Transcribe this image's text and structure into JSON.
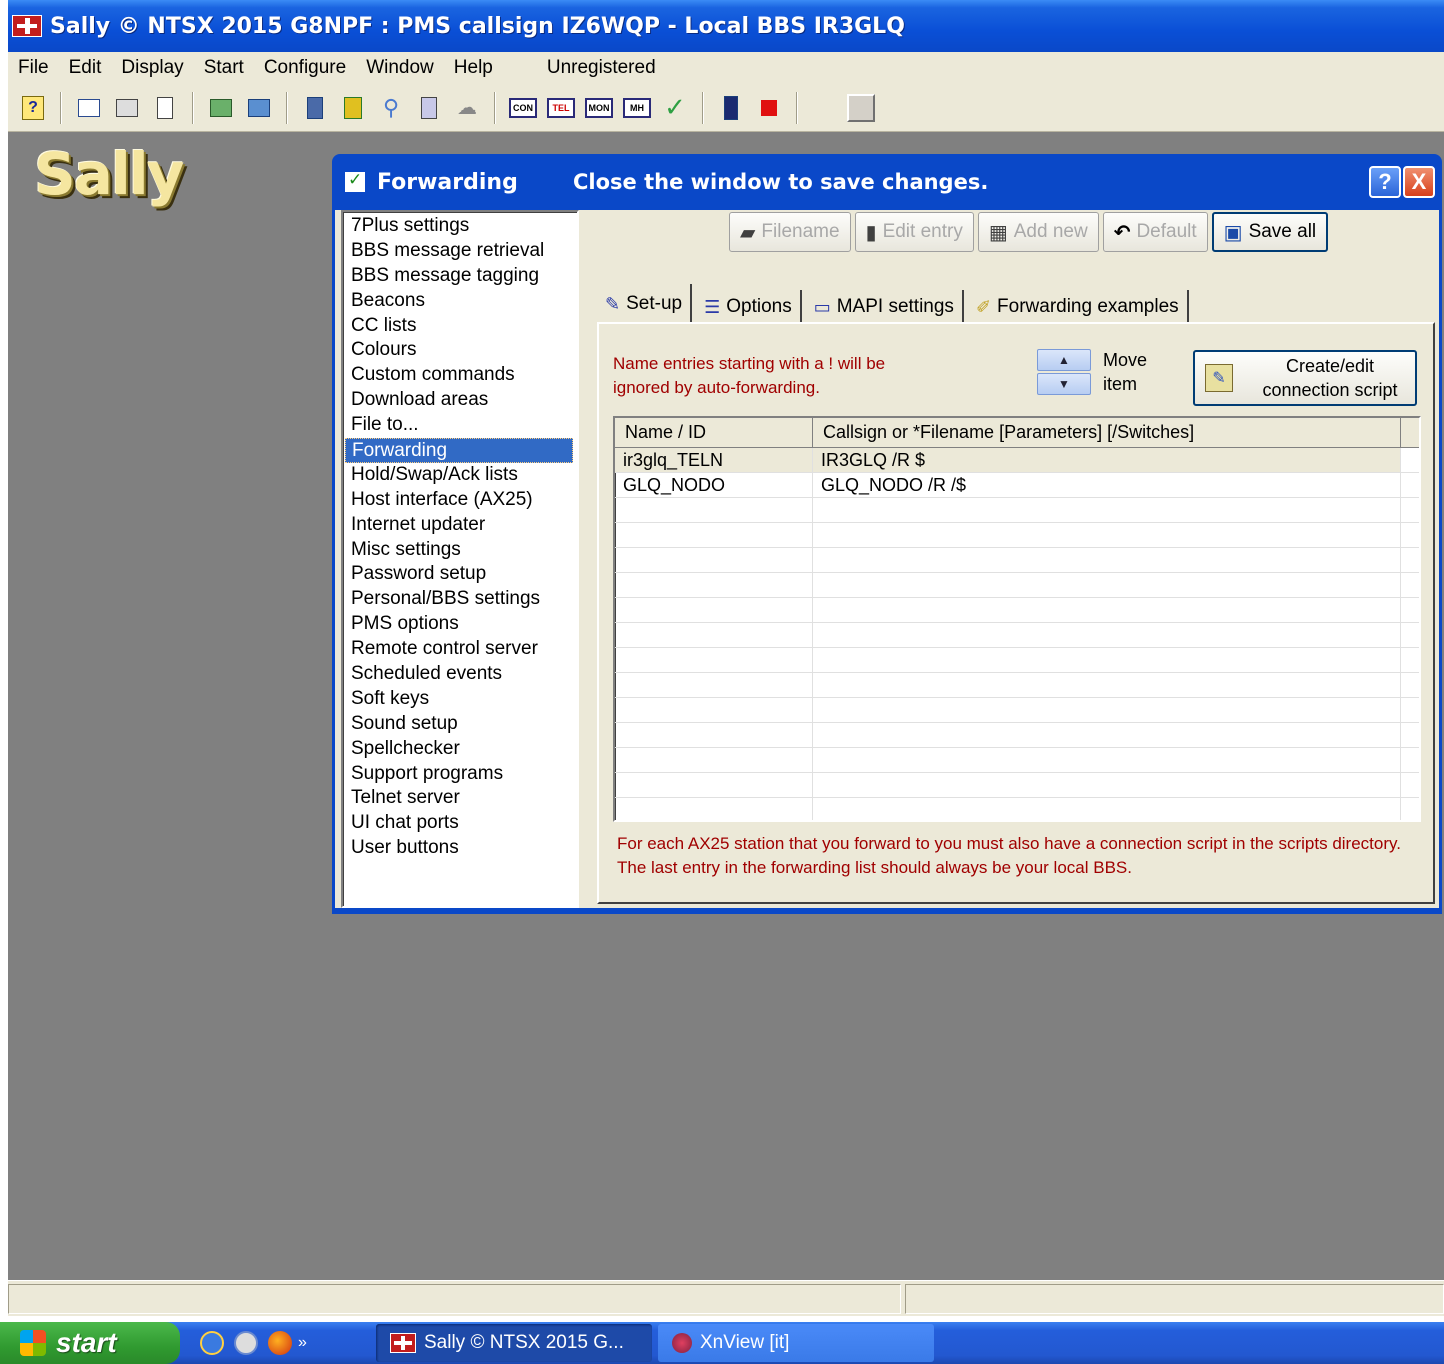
{
  "window": {
    "title": "Sally © NTSX 2015 G8NPF : PMS callsign IZ6WQP - Local BBS IR3GLQ"
  },
  "menu": [
    "File",
    "Edit",
    "Display",
    "Start",
    "Configure",
    "Window",
    "Help"
  ],
  "menu_status": "Unregistered",
  "toolbar": {
    "icons": [
      "help-icon",
      "window-icon",
      "card-icon",
      "new-doc-icon",
      "import-icon",
      "export-icon",
      "document-icon",
      "database-icon",
      "search-icon",
      "list-icon",
      "cloud-icon",
      "con-icon",
      "tel-icon",
      "mon-icon",
      "mh-icon",
      "check-icon",
      "exit-icon",
      "stop-icon",
      "gray-button-icon"
    ],
    "labels": {
      "con": "CON",
      "tel": "TEL",
      "mon": "MON",
      "mh": "MH"
    }
  },
  "logo": "Sally",
  "dialog": {
    "title": "Forwarding",
    "subtitle": "Close the window to save changes.",
    "help_label": "?",
    "close_label": "X",
    "categories": [
      "7Plus settings",
      "BBS message retrieval",
      "BBS message tagging",
      "Beacons",
      "CC lists",
      "Colours",
      "Custom commands",
      "Download areas",
      "File to...",
      "Forwarding",
      "Hold/Swap/Ack lists",
      "Host interface (AX25)",
      "Internet updater",
      "Misc settings",
      "Password setup",
      "Personal/BBS settings",
      "PMS options",
      "Remote control server",
      "Scheduled events",
      "Soft keys",
      "Sound setup",
      "Spellchecker",
      "Support programs",
      "Telnet server",
      "UI chat ports",
      "User buttons"
    ],
    "selected_category": "Forwarding",
    "actions": {
      "filename": "Filename",
      "edit_entry": "Edit entry",
      "add_new": "Add new",
      "default": "Default",
      "save_all": "Save all"
    },
    "tabs": [
      "Set-up",
      "Options",
      "MAPI settings",
      "Forwarding examples"
    ],
    "active_tab": "Set-up",
    "note_top": "Name entries starting with a ! will be ignored by auto-forwarding.",
    "move_label_1": "Move",
    "move_label_2": "item",
    "script_button_1": "Create/edit",
    "script_button_2": "connection script",
    "grid": {
      "headers": [
        "Name / ID",
        "Callsign or *Filename  [Parameters]  [/Switches]"
      ],
      "rows": [
        [
          "ir3glq_TELN",
          "IR3GLQ /R $"
        ],
        [
          "GLQ_NODO",
          "GLQ_NODO /R /$"
        ]
      ]
    },
    "note_bottom": "For each AX25 station that you forward to you must also have a connection script in the scripts directory. The last entry in the forwarding list should always be your local BBS."
  },
  "taskbar": {
    "start": "start",
    "tasks": [
      "Sally © NTSX 2015 G...",
      "XnView [it]"
    ]
  }
}
